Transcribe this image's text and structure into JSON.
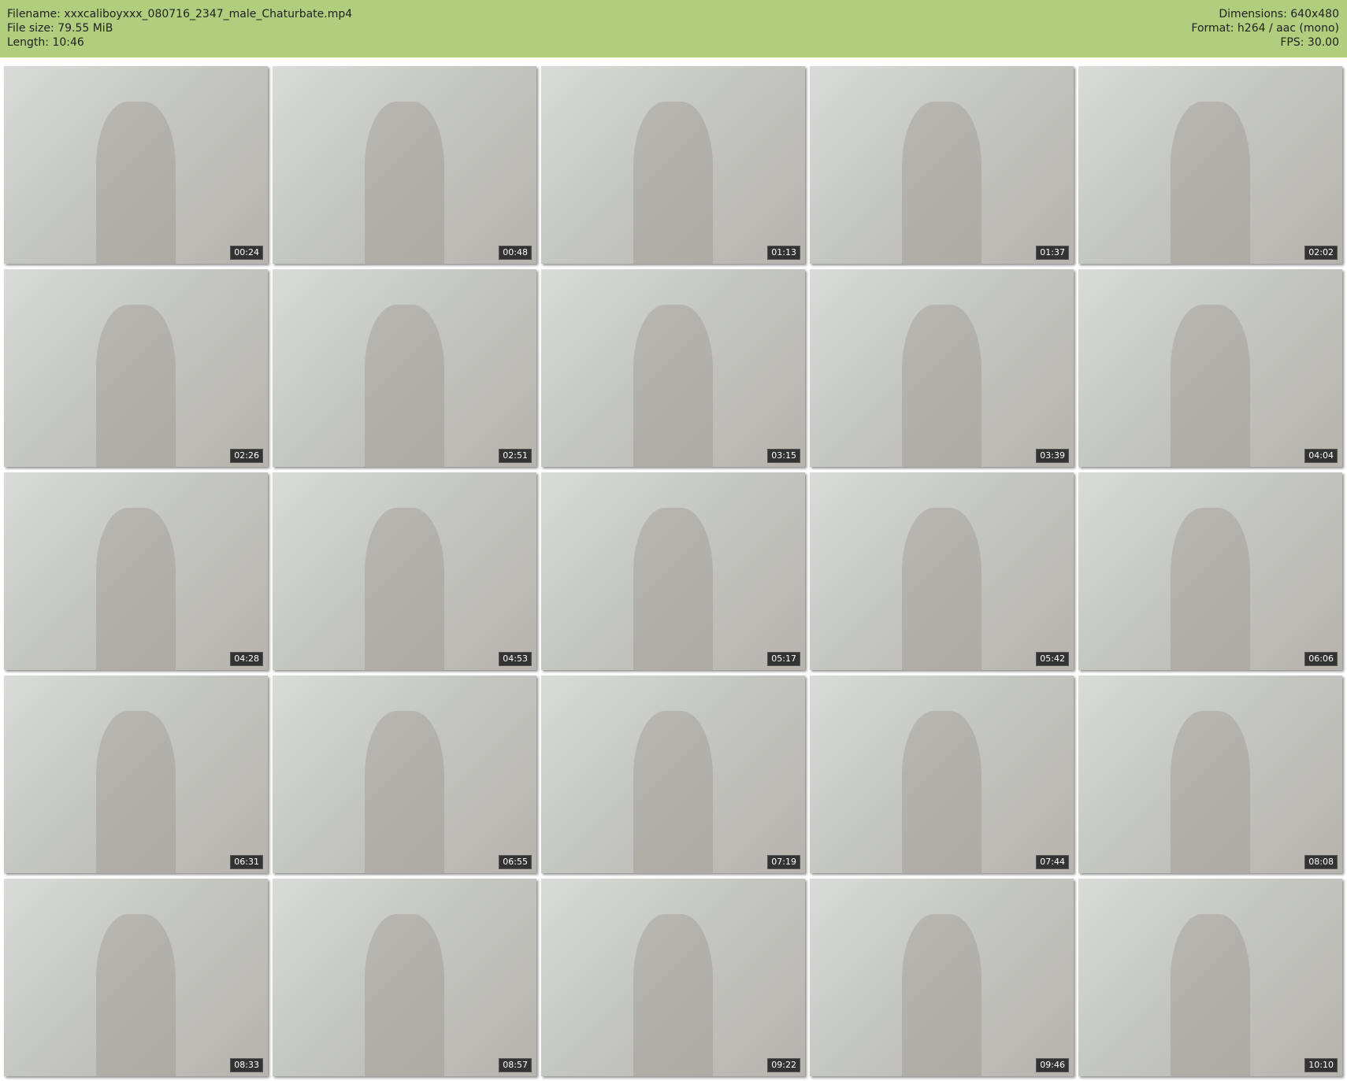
{
  "header": {
    "filename": "Filename: xxxcaliboyxxx_080716_2347_male_Chaturbate.mp4",
    "filesize": "File size: 79.55 MiB",
    "length": "Length: 10:46",
    "dimensions": "Dimensions: 640x480",
    "format": "Format: h264 / aac (mono)",
    "fps": "FPS: 30.00"
  },
  "thumbnails": [
    "00:24",
    "00:48",
    "01:13",
    "01:37",
    "02:02",
    "02:26",
    "02:51",
    "03:15",
    "03:39",
    "04:04",
    "04:28",
    "04:53",
    "05:17",
    "05:42",
    "06:06",
    "06:31",
    "06:55",
    "07:19",
    "07:44",
    "08:08",
    "08:33",
    "08:57",
    "09:22",
    "09:46",
    "10:10"
  ]
}
